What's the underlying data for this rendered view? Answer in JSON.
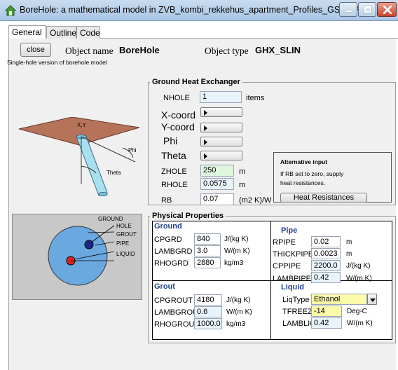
{
  "window": {
    "title": "BoreHole: a mathematical model in ZVB_kombi_rekkehus_apartment_Profiles_GSHP.Plant",
    "accent_color": "#4a9a3a"
  },
  "tabs": [
    {
      "label": "General",
      "active": true
    },
    {
      "label": "Outline",
      "active": false
    },
    {
      "label": "Code",
      "active": false
    }
  ],
  "header": {
    "close_label": "close",
    "object_name_label": "Object name",
    "object_name_value": "BoreHole",
    "object_type_label": "Object type",
    "object_type_value": "GHX_SLIN",
    "description": "Single-hole version of borehole model"
  },
  "illustration": {
    "xy_label": "X,Y",
    "phi_label": "Phi",
    "theta_label": "Theta"
  },
  "cross_section": {
    "ground": "GROUND",
    "hole": "HOLE",
    "grout": "GROUT",
    "pipe": "PIPE",
    "liquid": "LIQUID"
  },
  "ghx": {
    "title": "Ground Heat Exchanger",
    "nhole_label": "NHOLE",
    "nhole_value": "1",
    "nhole_unit": "items",
    "xcoord_label": "X-coord",
    "ycoord_label": "Y-coord",
    "phi_label": "Phi",
    "theta_label": "Theta",
    "zhole_label": "ZHOLE",
    "zhole_value": "250",
    "zhole_unit": "m",
    "rhole_label": "RHOLE",
    "rhole_value": "0.0575",
    "rhole_unit": "m",
    "rb_label": "RB",
    "rb_value": "0.07",
    "rb_unit": "(m2 K)/W",
    "alt_title": "Alternative input",
    "alt_text_1": "If RB set to zero, supply",
    "alt_text_2": "heat resistances.",
    "heat_res_button": "Heat Resistances"
  },
  "physical": {
    "title": "Physical Properties",
    "ground": {
      "title": "Ground",
      "rows": [
        {
          "label": "CPGRD",
          "value": "840",
          "unit": "J/(kg K)"
        },
        {
          "label": "LAMBGRD",
          "value": "3.0",
          "unit": "W/(m K)"
        },
        {
          "label": "RHOGRD",
          "value": "2880",
          "unit": "kg/m3"
        }
      ]
    },
    "pipe": {
      "title": "Pipe",
      "rows": [
        {
          "label": "RPIPE",
          "value": "0.02",
          "unit": "m"
        },
        {
          "label": "THICKPIPE",
          "value": "0.0023",
          "unit": "m"
        },
        {
          "label": "CPPIPE",
          "value": "2200.0",
          "unit": "J/(kg K)"
        },
        {
          "label": "LAMBPIPE",
          "value": "0.42",
          "unit": "W/(m K)"
        }
      ]
    },
    "grout": {
      "title": "Grout",
      "rows": [
        {
          "label": "CPGROUT",
          "value": "4180",
          "unit": "J/(kg K)"
        },
        {
          "label": "LAMBGROUT",
          "value": "0.6",
          "unit": "W/(m K)"
        },
        {
          "label": "RHOGROUT",
          "value": "1000.0",
          "unit": "kg/m3"
        }
      ]
    },
    "liquid": {
      "title": "Liquid",
      "liqtype_label": "LiqType",
      "liqtype_value": "Ethanol",
      "tfreeze_label": "TFREEZE",
      "tfreeze_value": "-14",
      "tfreeze_unit": "Deg-C",
      "lambliq_label": "LAMBLIQ",
      "lambliq_value": "0.42",
      "lambliq_unit": "W/(m K)"
    }
  }
}
